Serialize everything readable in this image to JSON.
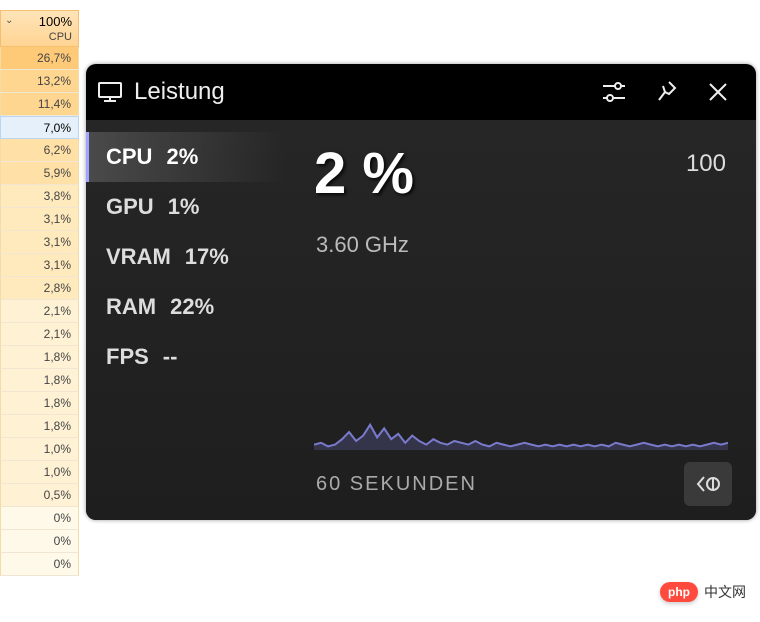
{
  "tm": {
    "header_pct": "100%",
    "header_label": "CPU",
    "rows": [
      {
        "v": "26,7%",
        "heat": 5,
        "sel": false
      },
      {
        "v": "13,2%",
        "heat": 4,
        "sel": false
      },
      {
        "v": "11,4%",
        "heat": 4,
        "sel": false
      },
      {
        "v": "7,0%",
        "heat": 0,
        "sel": true
      },
      {
        "v": "6,2%",
        "heat": 3,
        "sel": false
      },
      {
        "v": "5,9%",
        "heat": 3,
        "sel": false
      },
      {
        "v": "3,8%",
        "heat": 2,
        "sel": false
      },
      {
        "v": "3,1%",
        "heat": 2,
        "sel": false
      },
      {
        "v": "3,1%",
        "heat": 2,
        "sel": false
      },
      {
        "v": "3,1%",
        "heat": 2,
        "sel": false
      },
      {
        "v": "2,8%",
        "heat": 2,
        "sel": false
      },
      {
        "v": "2,1%",
        "heat": 1,
        "sel": false
      },
      {
        "v": "2,1%",
        "heat": 1,
        "sel": false
      },
      {
        "v": "1,8%",
        "heat": 1,
        "sel": false
      },
      {
        "v": "1,8%",
        "heat": 1,
        "sel": false
      },
      {
        "v": "1,8%",
        "heat": 1,
        "sel": false
      },
      {
        "v": "1,8%",
        "heat": 1,
        "sel": false
      },
      {
        "v": "1,0%",
        "heat": 1,
        "sel": false
      },
      {
        "v": "1,0%",
        "heat": 1,
        "sel": false
      },
      {
        "v": "0,5%",
        "heat": 1,
        "sel": false
      },
      {
        "v": "0%",
        "heat": 0,
        "sel": false
      },
      {
        "v": "0%",
        "heat": 0,
        "sel": false
      },
      {
        "v": "0%",
        "heat": 0,
        "sel": false
      }
    ]
  },
  "perf": {
    "title": "Leistung",
    "metrics": [
      {
        "label": "CPU",
        "value": "2%",
        "sel": true
      },
      {
        "label": "GPU",
        "value": "1%",
        "sel": false
      },
      {
        "label": "VRAM",
        "value": "17%",
        "sel": false
      },
      {
        "label": "RAM",
        "value": "22%",
        "sel": false
      },
      {
        "label": "FPS",
        "value": "--",
        "sel": false
      }
    ],
    "big_value": "2 %",
    "freq": "3.60 GHz",
    "y_max": "100",
    "y_min": "0",
    "x_label": "60 SEKUNDEN"
  },
  "watermark": {
    "pill": "php",
    "text": "中文网"
  },
  "chart_data": {
    "type": "line",
    "title": "CPU",
    "xlabel": "60 SEKUNDEN",
    "ylabel": "%",
    "ylim": [
      0,
      100
    ],
    "x_seconds": 60,
    "series": [
      {
        "name": "CPU %",
        "values": [
          3,
          4,
          2,
          3,
          6,
          10,
          5,
          8,
          14,
          7,
          12,
          6,
          9,
          4,
          8,
          5,
          3,
          6,
          4,
          3,
          5,
          4,
          3,
          5,
          3,
          2,
          4,
          3,
          2,
          3,
          4,
          3,
          2,
          3,
          2,
          3,
          2,
          3,
          2,
          3,
          2,
          3,
          2,
          4,
          3,
          2,
          3,
          4,
          3,
          2,
          3,
          2,
          3,
          2,
          3,
          2,
          3,
          4,
          3,
          4
        ]
      }
    ]
  }
}
